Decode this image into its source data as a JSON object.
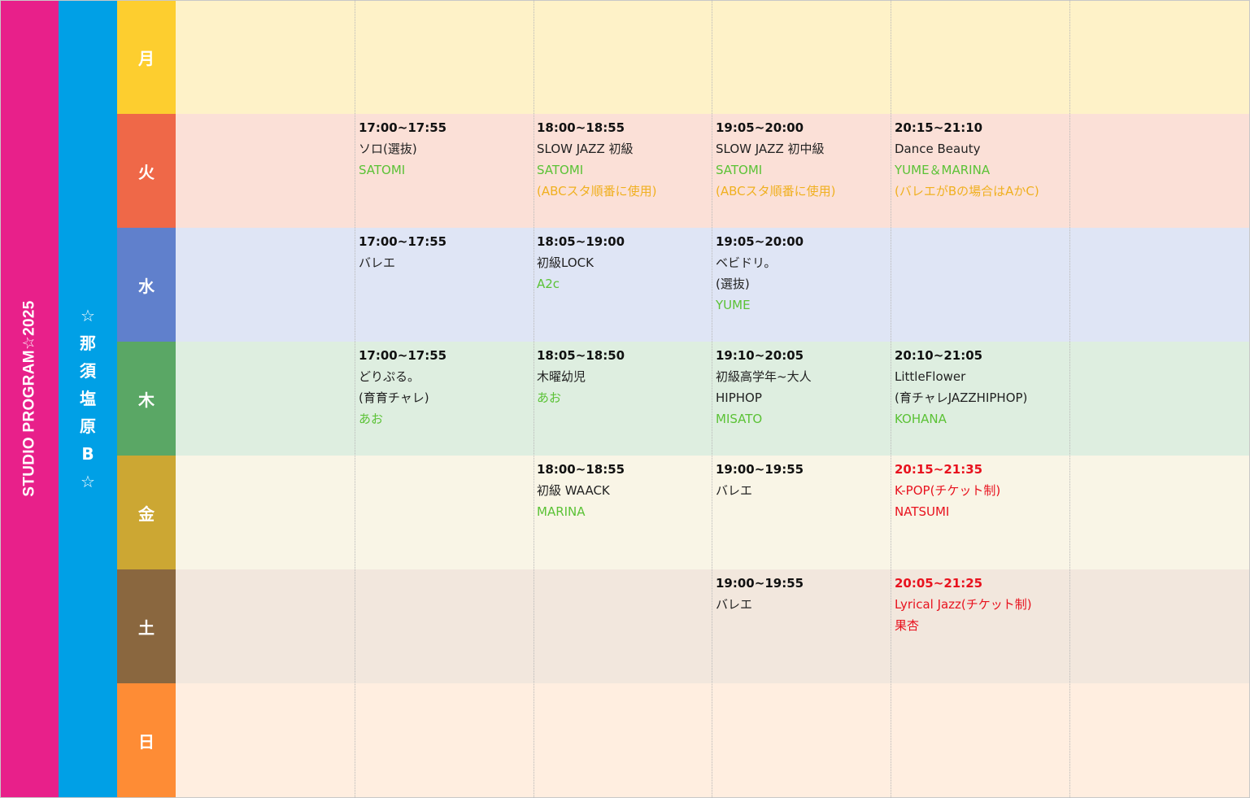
{
  "title_vertical": "STUDIO PROGRAM☆2025",
  "studio_chars": [
    "☆",
    "那",
    "須",
    "塩",
    "原",
    "B",
    "☆"
  ],
  "colors": {
    "title_band": "#e8208a",
    "studio_band": "#00a0e6",
    "instructor": "#5bc236",
    "note": "#f0b020",
    "ticket_class": "#e8121e"
  },
  "days": [
    {
      "label": "月",
      "color": "#fdce2f",
      "row_bg": "#fef2c8"
    },
    {
      "label": "火",
      "color": "#ef6848",
      "row_bg": "#fbe0d7"
    },
    {
      "label": "水",
      "color": "#6080cc",
      "row_bg": "#dfe5f5"
    },
    {
      "label": "木",
      "color": "#5aa765",
      "row_bg": "#deeee0"
    },
    {
      "label": "金",
      "color": "#cca733",
      "row_bg": "#f9f5e6"
    },
    {
      "label": "土",
      "color": "#8a673f",
      "row_bg": "#f2e7dd"
    },
    {
      "label": "日",
      "color": "#fe8c35",
      "row_bg": "#ffeee0"
    }
  ],
  "classes": {
    "tue": [
      {
        "time": "17:00~17:55",
        "name": "ソロ(選抜)",
        "instructor": "SATOMI"
      },
      {
        "time": "18:00~18:55",
        "name": "SLOW JAZZ 初級",
        "instructor": "SATOMI",
        "note": "(ABCスタ順番に使用)"
      },
      {
        "time": "19:05~20:00",
        "name": "SLOW JAZZ 初中級",
        "instructor": "SATOMI",
        "note": "(ABCスタ順番に使用)"
      },
      {
        "time": "20:15~21:10",
        "name": "Dance Beauty",
        "instructor": "YUME＆MARINA",
        "note": "(バレエがBの場合はAかC)"
      }
    ],
    "wed": [
      {
        "time": "17:00~17:55",
        "name": "バレエ"
      },
      {
        "time": "18:05~19:00",
        "name": "初級LOCK",
        "instructor": "A2c"
      },
      {
        "time": "19:05~20:00",
        "name": "ベビドリ。",
        "name2": "(選抜)",
        "instructor": "YUME"
      }
    ],
    "thu": [
      {
        "time": "17:00~17:55",
        "name": "どりぷる。",
        "name2": "(育育チャレ)",
        "instructor": "あお"
      },
      {
        "time": "18:05~18:50",
        "name": "木曜幼児",
        "instructor": "あお"
      },
      {
        "time": "19:10~20:05",
        "name": "初級高学年~大人",
        "name2": "HIPHOP",
        "instructor": "MISATO"
      },
      {
        "time": "20:10~21:05",
        "name": "LittleFlower",
        "name2": "(育チャレJAZZHIPHOP)",
        "instructor": "KOHANA"
      }
    ],
    "fri": [
      {
        "time": "18:00~18:55",
        "name": "初級 WAACK",
        "instructor": "MARINA"
      },
      {
        "time": "19:00~19:55",
        "name": "バレエ"
      },
      {
        "time": "20:15~21:35",
        "name": "K-POP(チケット制)",
        "instructor": "NATSUMI"
      }
    ],
    "sat": [
      {
        "time": "19:00~19:55",
        "name": "バレエ"
      },
      {
        "time": "20:05~21:25",
        "name": "Lyrical Jazz(チケット制)",
        "instructor": "果杏"
      }
    ]
  }
}
